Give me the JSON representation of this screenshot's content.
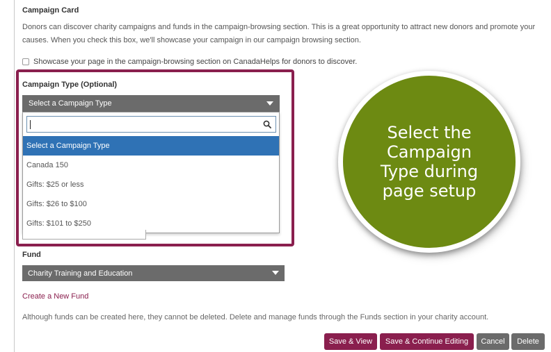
{
  "campaign_card": {
    "title": "Campaign Card",
    "description": "Donors can discover charity campaigns and funds in the campaign-browsing section. This is a great opportunity to attract new donors and promote your causes. When you check this box, we'll showcase your campaign in our campaign browsing section.",
    "showcase_label": "Showcase your page in the campaign-browsing section on CanadaHelps for donors to discover.",
    "showcase_checked": false
  },
  "campaign_type": {
    "label": "Campaign Type (Optional)",
    "selected": "Select a Campaign Type",
    "search_value": "",
    "options": [
      "Select a Campaign Type",
      "Canada 150",
      "Gifts: $25 or less",
      "Gifts: $26 to $100",
      "Gifts: $101 to $250"
    ],
    "highlighted_index": 0
  },
  "fund": {
    "label": "Fund",
    "selected": "Charity Training and Education",
    "create_link": "Create a New Fund",
    "note": "Although funds can be created here, they cannot be deleted. Delete and manage funds through the Funds section in your charity account."
  },
  "actions": {
    "save_view": "Save & View",
    "save_continue": "Save & Continue Editing",
    "cancel": "Cancel",
    "delete": "Delete"
  },
  "callout": {
    "text": "Select the Campaign Type during page setup"
  },
  "colors": {
    "brand": "#8a1f4e",
    "select_bg": "#6b6b6b",
    "option_active": "#2f72b5",
    "callout": "#6d8a12"
  }
}
